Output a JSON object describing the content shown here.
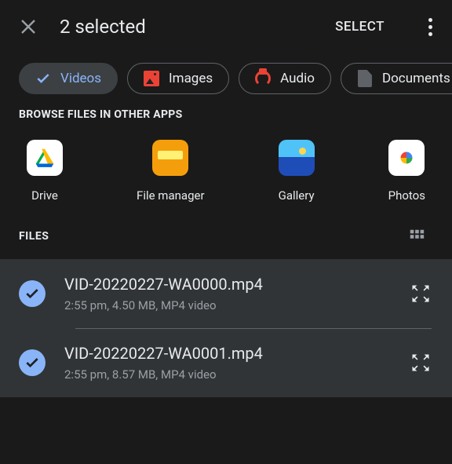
{
  "header": {
    "title": "2 selected",
    "select_button": "SELECT"
  },
  "chips": [
    {
      "label": "Videos",
      "active": true
    },
    {
      "label": "Images",
      "active": false
    },
    {
      "label": "Audio",
      "active": false
    },
    {
      "label": "Documents",
      "active": false
    }
  ],
  "browse_section": {
    "label": "BROWSE FILES IN OTHER APPS",
    "apps": [
      {
        "label": "Drive"
      },
      {
        "label": "File manager"
      },
      {
        "label": "Gallery"
      },
      {
        "label": "Photos"
      }
    ]
  },
  "files_section": {
    "label": "FILES"
  },
  "files": [
    {
      "name": "VID-20220227-WA0000.mp4",
      "meta": "2:55 pm, 4.50 MB, MP4 video",
      "selected": true
    },
    {
      "name": "VID-20220227-WA0001.mp4",
      "meta": "2:55 pm, 8.57 MB, MP4 video",
      "selected": true
    }
  ]
}
